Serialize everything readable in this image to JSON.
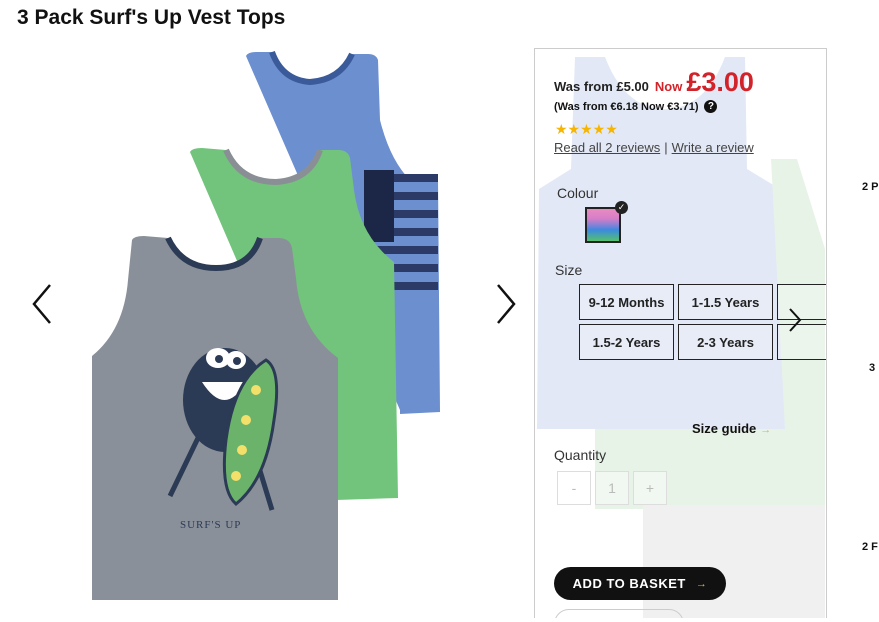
{
  "product": {
    "title": "3 Pack Surf's Up Vest Tops",
    "was_price": "Was from £5.00",
    "now_label": "Now",
    "now_price": "£3.00",
    "euro_prices": "(Was from €6.18 Now €3.71)",
    "rating_stars": "★★★★★",
    "read_reviews": "Read all 2 reviews",
    "review_separator": "|",
    "write_review": "Write a review",
    "print_text": "SURF'S UP"
  },
  "gallery": {
    "prev_icon": "chevron-left-icon",
    "next_icon": "chevron-right-icon"
  },
  "options": {
    "colour_label": "Colour",
    "size_label": "Size",
    "sizes": [
      "9-12 Months",
      "1-1.5 Years",
      "1.5-2 Years",
      "2-3 Years"
    ],
    "size_guide": "Size guide",
    "quantity_label": "Quantity",
    "qty_minus": "-",
    "qty_value": "1",
    "qty_plus": "+",
    "add_to_basket": "ADD TO BASKET",
    "arrow": "→"
  },
  "edge_text": {
    "a": "2 P",
    "b": "3",
    "c": "2 F"
  },
  "colors": {
    "price_red": "#d2232a",
    "star_yellow": "#f7b500",
    "button_black": "#111111"
  }
}
